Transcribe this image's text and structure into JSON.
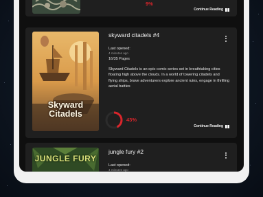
{
  "cards": [
    {
      "title": "",
      "progress_percent": 9,
      "progress_label": "9%",
      "continue_label": "Continue Reading"
    },
    {
      "title": "skyward citadels #4",
      "last_opened_label": "Last opened:",
      "last_opened_value": "4 minutes ago",
      "pages": "16/35 Pages",
      "description": "Skyward Citadels is an epic comic series set in breathtaking cities floating high above the clouds. In a world of towering citadels and flying ships, brave adventurers explore ancient ruins, engage in thrilling aerial battles",
      "cover_title": "Skyward Citadels",
      "progress_percent": 43,
      "progress_label": "43%",
      "continue_label": "Continue Reading"
    },
    {
      "title": "jungle fury #2",
      "last_opened_label": "Last opened:",
      "last_opened_value": "4 minutes ago",
      "cover_title": "JUNGLE FURY"
    }
  ],
  "colors": {
    "accent": "#d9252b",
    "card_bg": "#1f1f1f",
    "screen_bg": "#0f0f0f"
  }
}
